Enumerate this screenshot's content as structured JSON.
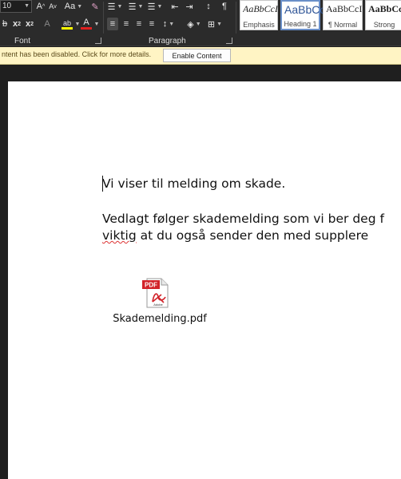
{
  "ribbon": {
    "font_size": "10",
    "case_label": "Aa",
    "grow_font_label": "A",
    "shrink_font_label": "A",
    "bold_label": "ab",
    "subscript_label": "x",
    "superscript_label": "x",
    "font_color_label": "A",
    "para_mark_label": "¶",
    "font_group_label": "Font",
    "paragraph_group_label": "Paragraph"
  },
  "styles": [
    {
      "sample": "AaBbCcI",
      "name": "Emphasis"
    },
    {
      "sample": "AaBbCc",
      "name": "Heading 1"
    },
    {
      "sample": "AaBbCcI",
      "name": "¶ Normal"
    },
    {
      "sample": "AaBbCcI",
      "name": "Strong"
    }
  ],
  "message_bar": {
    "text": "ntent has been disabled. Click for more details.",
    "button_label": "Enable Content"
  },
  "document": {
    "line1": "Vi viser til melding om skade.",
    "line2a": "Vedlagt følger skademelding som vi ber deg f",
    "line2b_prefix": "",
    "line2b_squiggle": "viktig",
    "line2b_rest": " at du også sender den med supplere"
  },
  "attachment": {
    "icon_label": "PDF",
    "icon_sub": "Adobe",
    "filename": "Skademelding.pdf"
  },
  "colors": {
    "ribbon_bg": "#2b2b2b",
    "message_bar_bg": "#fff4c4",
    "pdf_red": "#d2232a"
  }
}
